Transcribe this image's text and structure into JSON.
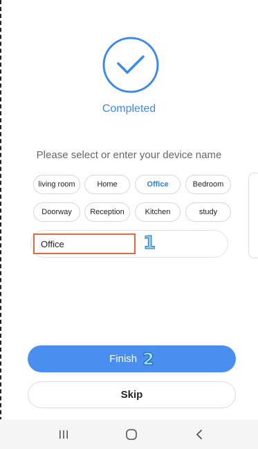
{
  "status": {
    "completed_label": "Completed",
    "check_icon": "checkmark-circle-icon",
    "accent_color": "#3a8ae8"
  },
  "prompt": "Please select or enter your device name",
  "chips": [
    {
      "label": "living room",
      "selected": false
    },
    {
      "label": "Home",
      "selected": false
    },
    {
      "label": "Office",
      "selected": true
    },
    {
      "label": "Bedroom",
      "selected": false
    },
    {
      "label": "Doorway",
      "selected": false
    },
    {
      "label": "Reception",
      "selected": false
    },
    {
      "label": "Kitchen",
      "selected": false
    },
    {
      "label": "study",
      "selected": false
    }
  ],
  "name_input": {
    "value": "Office",
    "annotation": "1"
  },
  "buttons": {
    "finish_label": "Finish",
    "finish_annotation": "2",
    "skip_label": "Skip",
    "primary_color": "#4a8ff0"
  },
  "system_nav": {
    "recent_icon": "recent-apps-icon",
    "home_icon": "home-icon",
    "back_icon": "back-icon"
  }
}
